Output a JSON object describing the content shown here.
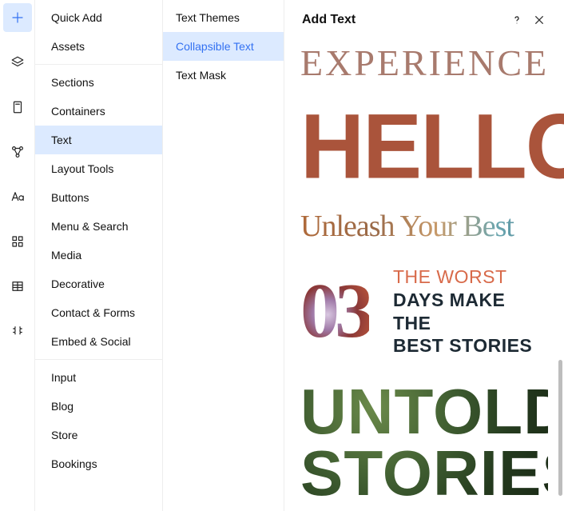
{
  "panel_title": "Add Text",
  "rail": [
    {
      "name": "add-icon",
      "active": true
    },
    {
      "name": "layers-icon",
      "active": false
    },
    {
      "name": "page-icon",
      "active": false
    },
    {
      "name": "nodes-icon",
      "active": false
    },
    {
      "name": "typography-icon",
      "active": false
    },
    {
      "name": "apps-icon",
      "active": false
    },
    {
      "name": "table-icon",
      "active": false
    },
    {
      "name": "code-icon",
      "active": false
    }
  ],
  "categories": [
    {
      "group": 0,
      "label": "Quick Add",
      "selected": false
    },
    {
      "group": 0,
      "label": "Assets",
      "selected": false
    },
    {
      "group": 1,
      "label": "Sections",
      "selected": false
    },
    {
      "group": 1,
      "label": "Containers",
      "selected": false
    },
    {
      "group": 1,
      "label": "Text",
      "selected": true
    },
    {
      "group": 1,
      "label": "Layout Tools",
      "selected": false
    },
    {
      "group": 1,
      "label": "Buttons",
      "selected": false
    },
    {
      "group": 1,
      "label": "Menu & Search",
      "selected": false
    },
    {
      "group": 1,
      "label": "Media",
      "selected": false
    },
    {
      "group": 1,
      "label": "Decorative",
      "selected": false
    },
    {
      "group": 1,
      "label": "Contact & Forms",
      "selected": false
    },
    {
      "group": 1,
      "label": "Embed & Social",
      "selected": false
    },
    {
      "group": 2,
      "label": "Input",
      "selected": false
    },
    {
      "group": 2,
      "label": "Blog",
      "selected": false
    },
    {
      "group": 2,
      "label": "Store",
      "selected": false
    },
    {
      "group": 2,
      "label": "Bookings",
      "selected": false
    }
  ],
  "sub_items": [
    {
      "label": "Text Themes",
      "selected": false
    },
    {
      "label": "Collapsible Text",
      "selected": true
    },
    {
      "label": "Text Mask",
      "selected": false
    }
  ],
  "samples": {
    "s1": "EXPERIENCE",
    "s2": "HELLO",
    "s3": "Unleash Your Best",
    "s4_num": "03",
    "s4_line1": "THE WORST",
    "s4_line2": "DAYS MAKE THE",
    "s4_line3": "BEST STORIES",
    "s5_line1": "UNTOLD",
    "s5_line2": "STORIES"
  }
}
